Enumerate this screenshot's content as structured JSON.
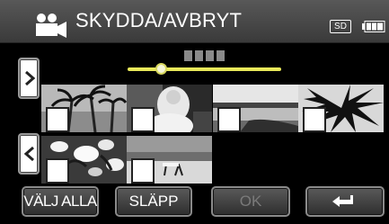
{
  "header": {
    "title": "SKYDDA/AVBRYT",
    "storage_label": "SD",
    "icon": "video-camera-icon",
    "battery_icon": "battery-full-icon"
  },
  "pagination": {
    "indicator_icon": "page-dots-icon",
    "position": 0.22
  },
  "navigation": {
    "next_icon": "chevron-right-icon",
    "prev_icon": "chevron-left-icon"
  },
  "thumbnails": [
    {
      "scene": "palm trees",
      "checked": false
    },
    {
      "scene": "person in white",
      "checked": false
    },
    {
      "scene": "lake shoreline",
      "checked": false
    },
    {
      "scene": "palm leaves silhouette",
      "checked": false
    },
    {
      "scene": "flowers",
      "checked": false
    },
    {
      "scene": "beach with chair",
      "checked": false
    }
  ],
  "footer": {
    "select_all_label": "VÄLJ ALLA",
    "release_label": "SLÄPP",
    "ok_label": "OK",
    "back_icon": "return-arrow-icon"
  },
  "colors": {
    "slider": "#e8e85a",
    "header_bg": "#4a4a4a"
  }
}
